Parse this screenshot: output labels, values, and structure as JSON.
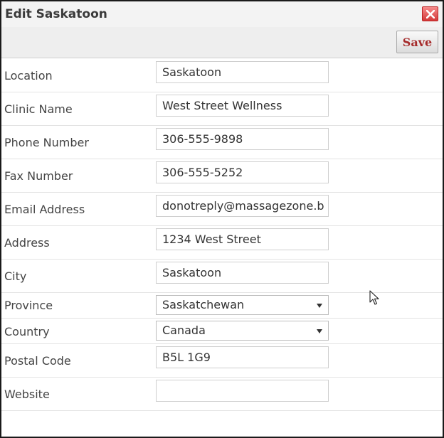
{
  "dialog": {
    "title": "Edit Saskatoon"
  },
  "toolbar": {
    "save_label": "Save"
  },
  "fields": {
    "location": {
      "label": "Location",
      "value": "Saskatoon"
    },
    "clinic_name": {
      "label": "Clinic Name",
      "value": "West Street Wellness"
    },
    "phone": {
      "label": "Phone Number",
      "value": "306-555-9898"
    },
    "fax": {
      "label": "Fax Number",
      "value": "306-555-5252"
    },
    "email": {
      "label": "Email Address",
      "value": "donotreply@massagezone.b"
    },
    "address": {
      "label": "Address",
      "value": "1234 West Street"
    },
    "city": {
      "label": "City",
      "value": "Saskatoon"
    },
    "province": {
      "label": "Province",
      "value": "Saskatchewan"
    },
    "country": {
      "label": "Country",
      "value": "Canada"
    },
    "postal_code": {
      "label": "Postal Code",
      "value": "B5L 1G9"
    },
    "website": {
      "label": "Website",
      "value": ""
    }
  },
  "icons": {
    "close": "close-icon",
    "dropdown": "chevron-down-icon",
    "cursor": "mouse-pointer-icon"
  },
  "colors": {
    "close_button": "#d43a3a",
    "save_text": "#a52a2a"
  }
}
